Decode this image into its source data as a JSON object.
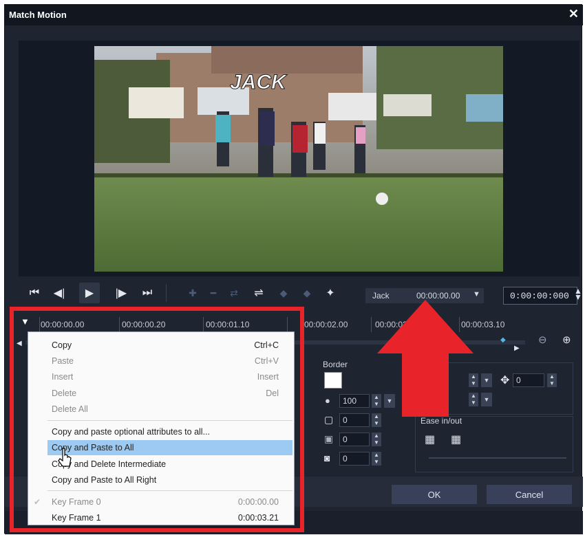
{
  "window": {
    "title": "Match Motion",
    "close_glyph": "✕"
  },
  "preview": {
    "overlay_text": "JACK"
  },
  "toolbar": {
    "object_name": "Jack",
    "object_timecode": "00:00:00.00",
    "timecode": "0:00:00:000"
  },
  "ruler": {
    "ticks": [
      "00:00:00.00",
      "00:00:00.20",
      "00:00:01.10",
      "00:00:02.00",
      "00:00:02",
      "00:00:03.10"
    ]
  },
  "properties": {
    "border_label": "Border",
    "opacity": "100",
    "border_width": "0",
    "field_2": "0",
    "field_3": "0",
    "rotate_value": "0",
    "ease_label": "Ease in/out"
  },
  "context_menu": {
    "items": [
      {
        "label": "Copy",
        "shortcut": "Ctrl+C"
      },
      {
        "label": "Paste",
        "shortcut": "Ctrl+V"
      },
      {
        "label": "Insert",
        "shortcut": "Insert"
      },
      {
        "label": "Delete",
        "shortcut": "Del"
      },
      {
        "label": "Delete All",
        "shortcut": ""
      },
      {
        "label": "Copy and paste optional attributes to all...",
        "shortcut": ""
      },
      {
        "label": "Copy and Paste to All",
        "shortcut": ""
      },
      {
        "label": "Copy and Delete Intermediate",
        "shortcut": ""
      },
      {
        "label": "Copy and Paste to All Right",
        "shortcut": ""
      }
    ],
    "keyframes": [
      {
        "label": "Key  Frame  0",
        "time": "0:00:00.00"
      },
      {
        "label": "Key  Frame  1",
        "time": "0:00:03.21"
      }
    ]
  },
  "buttons": {
    "ok": "OK",
    "cancel": "Cancel"
  },
  "colors": {
    "highlight_box": "#e8232a",
    "menu_hover": "#9ccaf2"
  }
}
